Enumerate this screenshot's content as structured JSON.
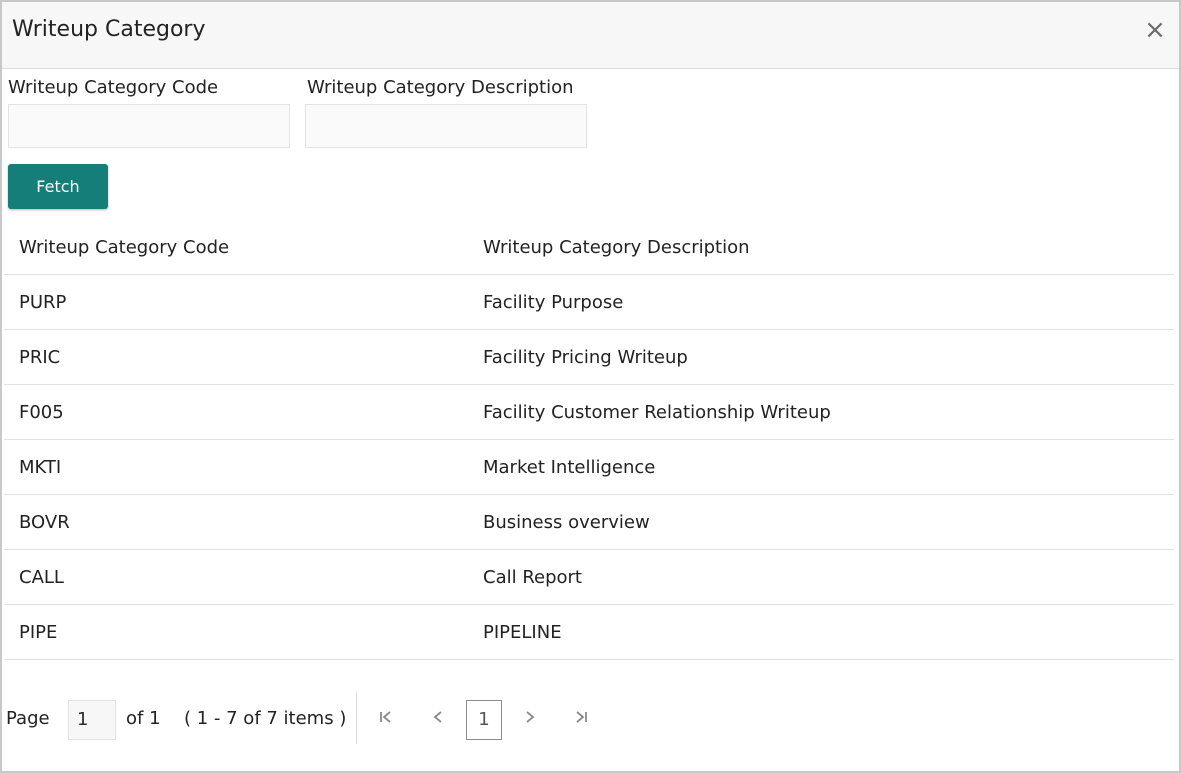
{
  "dialog": {
    "title": "Writeup Category",
    "close_symbol": "×"
  },
  "filters": {
    "code_label": "Writeup Category Code",
    "code_value": "",
    "description_label": "Writeup Category Description",
    "description_value": "",
    "fetch_label": "Fetch"
  },
  "table": {
    "columns": [
      "Writeup Category Code",
      "Writeup Category Description"
    ],
    "rows": [
      {
        "code": "PURP",
        "description": "Facility Purpose"
      },
      {
        "code": "PRIC",
        "description": "Facility Pricing Writeup"
      },
      {
        "code": "F005",
        "description": "Facility Customer Relationship Writeup"
      },
      {
        "code": "MKTI",
        "description": "Market Intelligence"
      },
      {
        "code": "BOVR",
        "description": "Business overview"
      },
      {
        "code": "CALL",
        "description": "Call Report"
      },
      {
        "code": "PIPE",
        "description": "PIPELINE"
      }
    ]
  },
  "pager": {
    "page_label": "Page",
    "page_value": "1",
    "of_label": "of 1",
    "items_label": "( 1 - 7 of 7 items )",
    "current_page": "1",
    "icons": {
      "first": "first-page-icon",
      "prev": "previous-page-icon",
      "next": "next-page-icon",
      "last": "last-page-icon"
    }
  },
  "colors": {
    "accent": "#167e78",
    "header_bg": "#f7f7f7",
    "border": "#c8c8c8"
  }
}
